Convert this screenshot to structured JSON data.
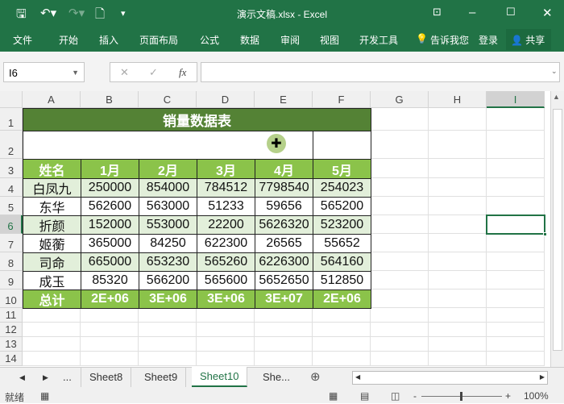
{
  "window": {
    "title": "演示文稿.xlsx - Excel"
  },
  "ribbon": {
    "tabs": [
      "文件",
      "开始",
      "插入",
      "页面布局",
      "公式",
      "数据",
      "审阅",
      "视图",
      "开发工具"
    ],
    "tell_me": "告诉我您",
    "login": "登录",
    "share": "共享"
  },
  "formula_bar": {
    "name_box": "I6",
    "formula": ""
  },
  "columns": [
    "A",
    "B",
    "C",
    "D",
    "E",
    "F",
    "G",
    "H",
    "I"
  ],
  "rows": [
    "1",
    "2",
    "3",
    "4",
    "5",
    "6",
    "7",
    "8",
    "9",
    "10",
    "11",
    "12",
    "13",
    "14"
  ],
  "sheet": {
    "title": "销量数据表",
    "headers": [
      "姓名",
      "1月",
      "2月",
      "3月",
      "4月",
      "5月"
    ],
    "data": [
      [
        "白凤九",
        "250000",
        "854000",
        "784512",
        "7798540",
        "254023"
      ],
      [
        "东华",
        "562600",
        "563000",
        "51233",
        "59656",
        "565200"
      ],
      [
        "折颜",
        "152000",
        "553000",
        "22200",
        "5626320",
        "523200"
      ],
      [
        "姬蘅",
        "365000",
        "84250",
        "622300",
        "26565",
        "55652"
      ],
      [
        "司命",
        "665000",
        "653230",
        "565260",
        "6226300",
        "564160"
      ],
      [
        "成玉",
        "85320",
        "566200",
        "565600",
        "5652650",
        "512850"
      ]
    ],
    "total": [
      "总计",
      "2E+06",
      "3E+06",
      "3E+06",
      "3E+07",
      "2E+06"
    ]
  },
  "sheet_tabs": [
    "Sheet8",
    "Sheet9",
    "Sheet10",
    "She..."
  ],
  "active_tab": "Sheet10",
  "status": {
    "ready": "就绪",
    "zoom": "100%"
  },
  "colors": {
    "brand": "#217346",
    "title_fill": "#548235",
    "header_fill": "#8BC34A",
    "band_fill": "#E2EFDA"
  }
}
